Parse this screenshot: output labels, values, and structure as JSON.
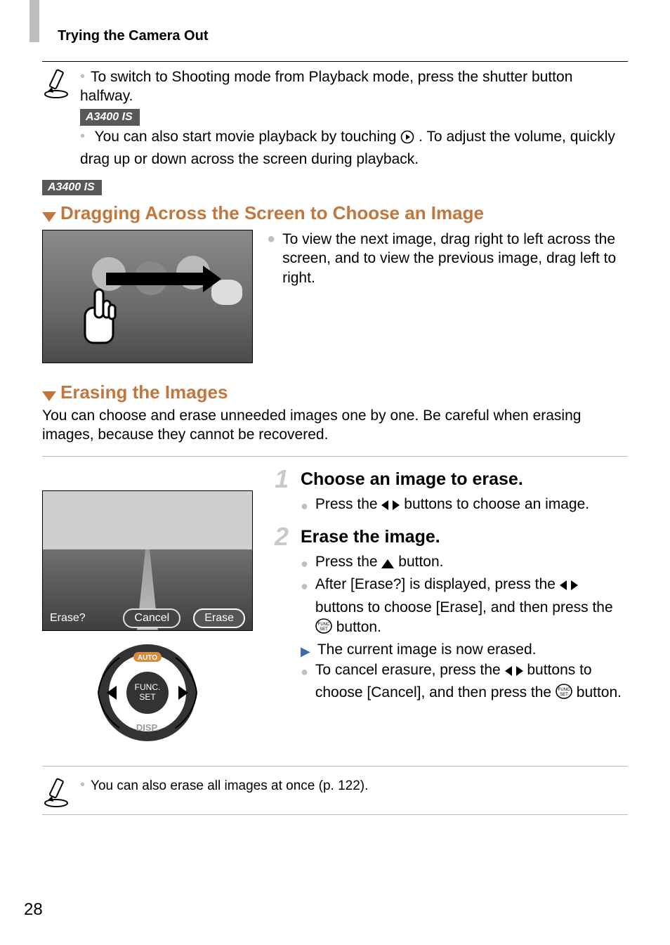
{
  "header": {
    "title": "Trying the Camera Out"
  },
  "badges": {
    "model": "A3400 IS"
  },
  "tip1": {
    "line1": "To switch to Shooting mode from Playback mode, press the shutter button halfway.",
    "line2": "You can also start movie playback by touching ",
    "line2_tail": ". To adjust the volume, quickly drag up or down across the screen during playback."
  },
  "section1": {
    "title": "Dragging Across the Screen to Choose an Image",
    "body": "To view the next image, drag right to left across the screen, and to view the previous image, drag left to right."
  },
  "section2": {
    "title": "Erasing the Images",
    "intro": "You can choose and erase unneeded images one by one. Be careful when erasing images, because they cannot be recovered."
  },
  "screen": {
    "prompt": "Erase?",
    "cancel": "Cancel",
    "erase": "Erase"
  },
  "dial": {
    "top": "AUTO",
    "center_top": "FUNC.",
    "center_bottom": "SET",
    "bottom": "DISP."
  },
  "steps": {
    "s1": {
      "num": "1",
      "title": "Choose an image to erase.",
      "b1_pre": "Press the ",
      "b1_post": " buttons to choose an image."
    },
    "s2": {
      "num": "2",
      "title": "Erase the image.",
      "b1_pre": "Press the ",
      "b1_post": " button.",
      "b2_pre": "After [Erase?] is displayed, press the ",
      "b2_mid": " buttons to choose [Erase], and then press the ",
      "b2_post": " button.",
      "b3": "The current image is now erased.",
      "b4_pre": "To cancel erasure, press the ",
      "b4_mid": " buttons to choose [Cancel], and then press the ",
      "b4_post": " button."
    }
  },
  "tip2": {
    "text": "You can also erase all images at once (p. 122)."
  },
  "page_number": "28"
}
